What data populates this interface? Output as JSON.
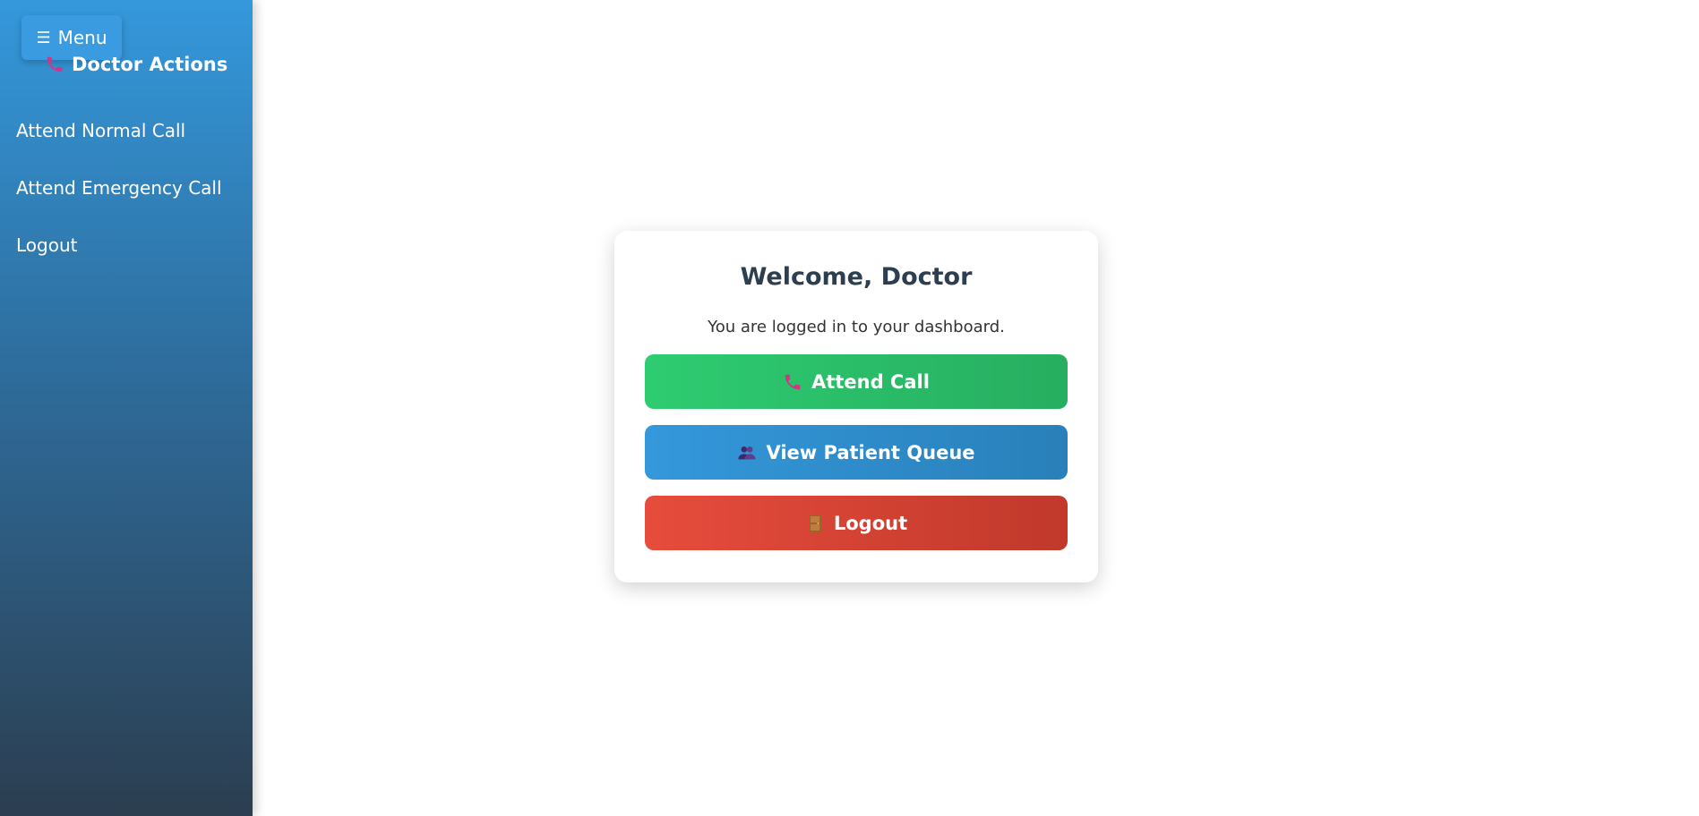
{
  "sidebar": {
    "menu_toggle": {
      "icon": "☰",
      "label": "Menu"
    },
    "title": "Doctor Actions",
    "title_icon": "phone-icon",
    "items": [
      {
        "label": "Attend Normal Call"
      },
      {
        "label": "Attend Emergency Call"
      },
      {
        "label": "Logout"
      }
    ]
  },
  "card": {
    "title": "Welcome, Doctor",
    "subtitle": "You are logged in to your dashboard.",
    "buttons": [
      {
        "label": "Attend Call",
        "icon": "phone-icon",
        "color": "#2ecc71"
      },
      {
        "label": "View Patient Queue",
        "icon": "people-icon",
        "color": "#3498db"
      },
      {
        "label": "Logout",
        "icon": "door-icon",
        "color": "#e74c3c"
      }
    ]
  },
  "colors": {
    "sidebar_top": "#3498db",
    "sidebar_bottom": "#2c3e50",
    "title_text": "#2c3e50",
    "phone_icon": "#d63384"
  }
}
